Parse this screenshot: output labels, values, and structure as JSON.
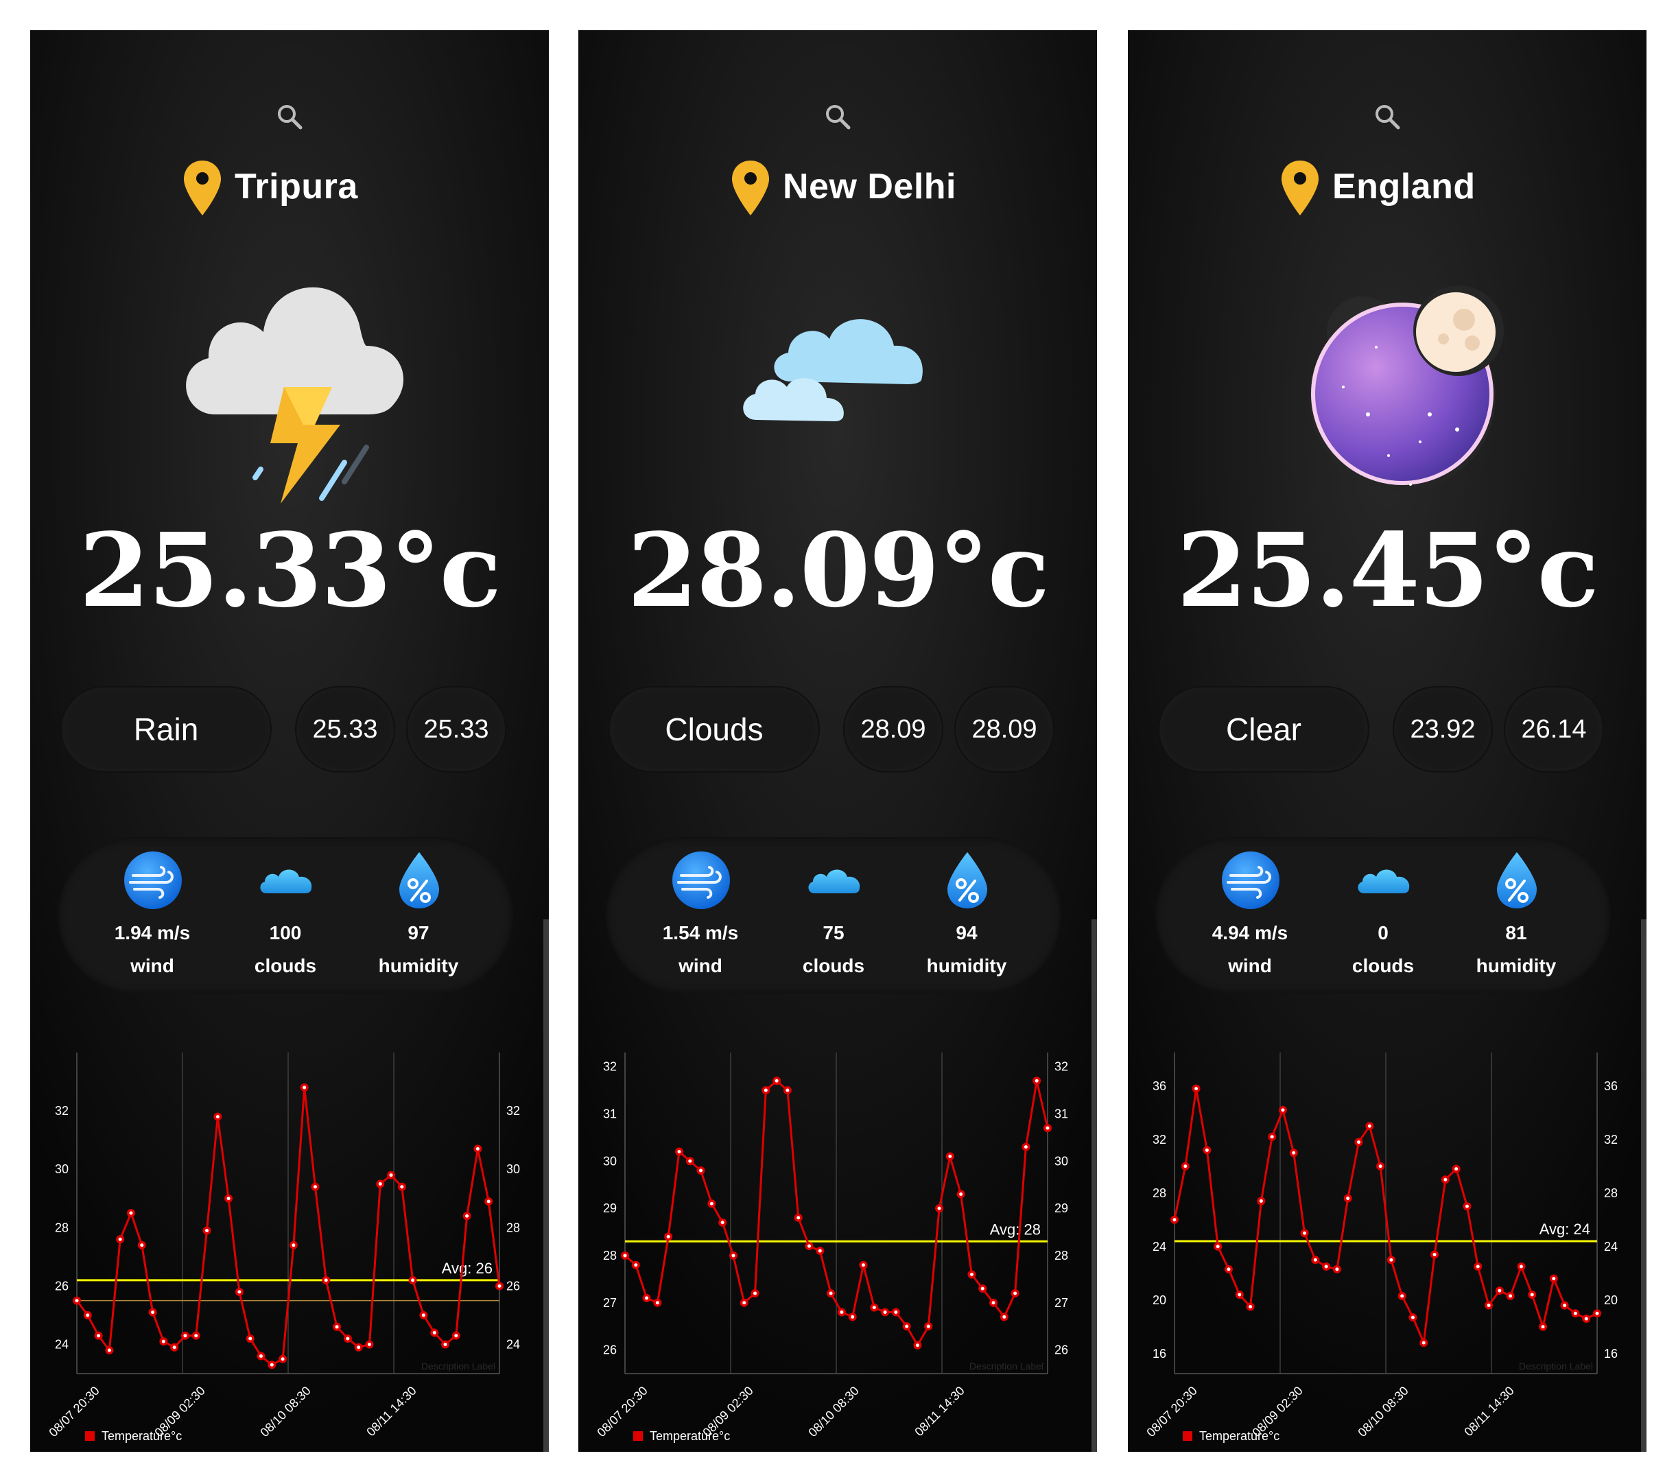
{
  "panels": [
    {
      "city": "Tripura",
      "temperature": "25.33°c",
      "condition": "Rain",
      "temp_min": "25.33",
      "temp_max": "25.33",
      "weather_icon": "thunderstorm-icon",
      "stats": {
        "wind_value": "1.94 m/s",
        "wind_label": "wind",
        "clouds_value": "100",
        "clouds_label": "clouds",
        "humidity_value": "97",
        "humidity_label": "humidity"
      },
      "chart_data": {
        "type": "line",
        "x_tick_labels": [
          "08/07 20:30",
          "08/09 02:30",
          "08/10 08:30",
          "08/11 14:30"
        ],
        "ylim": [
          23,
          34
        ],
        "y_ticks": [
          24,
          26,
          28,
          30,
          32
        ],
        "series": [
          {
            "name": "Temperature°c",
            "color": "#e00000",
            "values": [
              25.5,
              25.0,
              24.3,
              23.8,
              27.6,
              28.5,
              27.4,
              25.1,
              24.1,
              23.9,
              24.3,
              24.3,
              27.9,
              31.8,
              29.0,
              25.8,
              24.2,
              23.6,
              23.3,
              23.5,
              27.4,
              32.8,
              29.4,
              26.2,
              24.6,
              24.2,
              23.9,
              24.0,
              29.5,
              29.8,
              29.4,
              26.2,
              25.0,
              24.4,
              24.0,
              24.3,
              28.4,
              30.7,
              28.9,
              26.0
            ]
          }
        ],
        "average": {
          "label": "Avg: 26",
          "value": 26.2,
          "color": "#f6f600"
        },
        "secondary_line": 25.5,
        "legend": "bottom-left",
        "watermark": "Description Label"
      }
    },
    {
      "city": "New Delhi",
      "temperature": "28.09°c",
      "condition": "Clouds",
      "temp_min": "28.09",
      "temp_max": "28.09",
      "weather_icon": "clouds-icon",
      "stats": {
        "wind_value": "1.54 m/s",
        "wind_label": "wind",
        "clouds_value": "75",
        "clouds_label": "clouds",
        "humidity_value": "94",
        "humidity_label": "humidity"
      },
      "chart_data": {
        "type": "line",
        "x_tick_labels": [
          "08/07 20:30",
          "08/09 02:30",
          "08/10 08:30",
          "08/11 14:30"
        ],
        "ylim": [
          25.5,
          32.3
        ],
        "y_ticks": [
          26,
          27,
          28,
          29,
          30,
          31,
          32
        ],
        "series": [
          {
            "name": "Temperature°c",
            "color": "#e00000",
            "values": [
              28.0,
              27.8,
              27.1,
              27.0,
              28.4,
              30.2,
              30.0,
              29.8,
              29.1,
              28.7,
              28.0,
              27.0,
              27.2,
              31.5,
              31.7,
              31.5,
              28.8,
              28.2,
              28.1,
              27.2,
              26.8,
              26.7,
              27.8,
              26.9,
              26.8,
              26.8,
              26.5,
              26.1,
              26.5,
              29.0,
              30.1,
              29.3,
              27.6,
              27.3,
              27.0,
              26.7,
              27.2,
              30.3,
              31.7,
              30.7
            ]
          }
        ],
        "average": {
          "label": "Avg: 28",
          "value": 28.3,
          "color": "#f6f600"
        },
        "legend": "bottom-left",
        "watermark": "Description Label"
      }
    },
    {
      "city": "England",
      "temperature": "25.45°c",
      "condition": "Clear",
      "temp_min": "23.92",
      "temp_max": "26.14",
      "weather_icon": "moon-night-icon",
      "stats": {
        "wind_value": "4.94 m/s",
        "wind_label": "wind",
        "clouds_value": "0",
        "clouds_label": "clouds",
        "humidity_value": "81",
        "humidity_label": "humidity"
      },
      "chart_data": {
        "type": "line",
        "x_tick_labels": [
          "08/07 20:30",
          "08/09 02:30",
          "08/10 08:30",
          "08/11 14:30"
        ],
        "ylim": [
          14.5,
          38.5
        ],
        "y_ticks": [
          16,
          20,
          24,
          28,
          32,
          36
        ],
        "series": [
          {
            "name": "Temperature°c",
            "color": "#e00000",
            "values": [
              26.0,
              30.0,
              35.8,
              31.2,
              24.0,
              22.3,
              20.4,
              19.5,
              27.4,
              32.2,
              34.2,
              31.0,
              25.0,
              23.0,
              22.5,
              22.3,
              27.6,
              31.8,
              33.0,
              30.0,
              23.0,
              20.3,
              18.7,
              16.8,
              23.4,
              29.0,
              29.8,
              27.0,
              22.5,
              19.6,
              20.7,
              20.3,
              22.5,
              20.4,
              18.0,
              21.6,
              19.6,
              19.0,
              18.6,
              19.0
            ]
          }
        ],
        "average": {
          "label": "Avg: 24",
          "value": 24.4,
          "color": "#f6f600"
        },
        "legend": "bottom-left",
        "watermark": "Description Label"
      }
    }
  ]
}
